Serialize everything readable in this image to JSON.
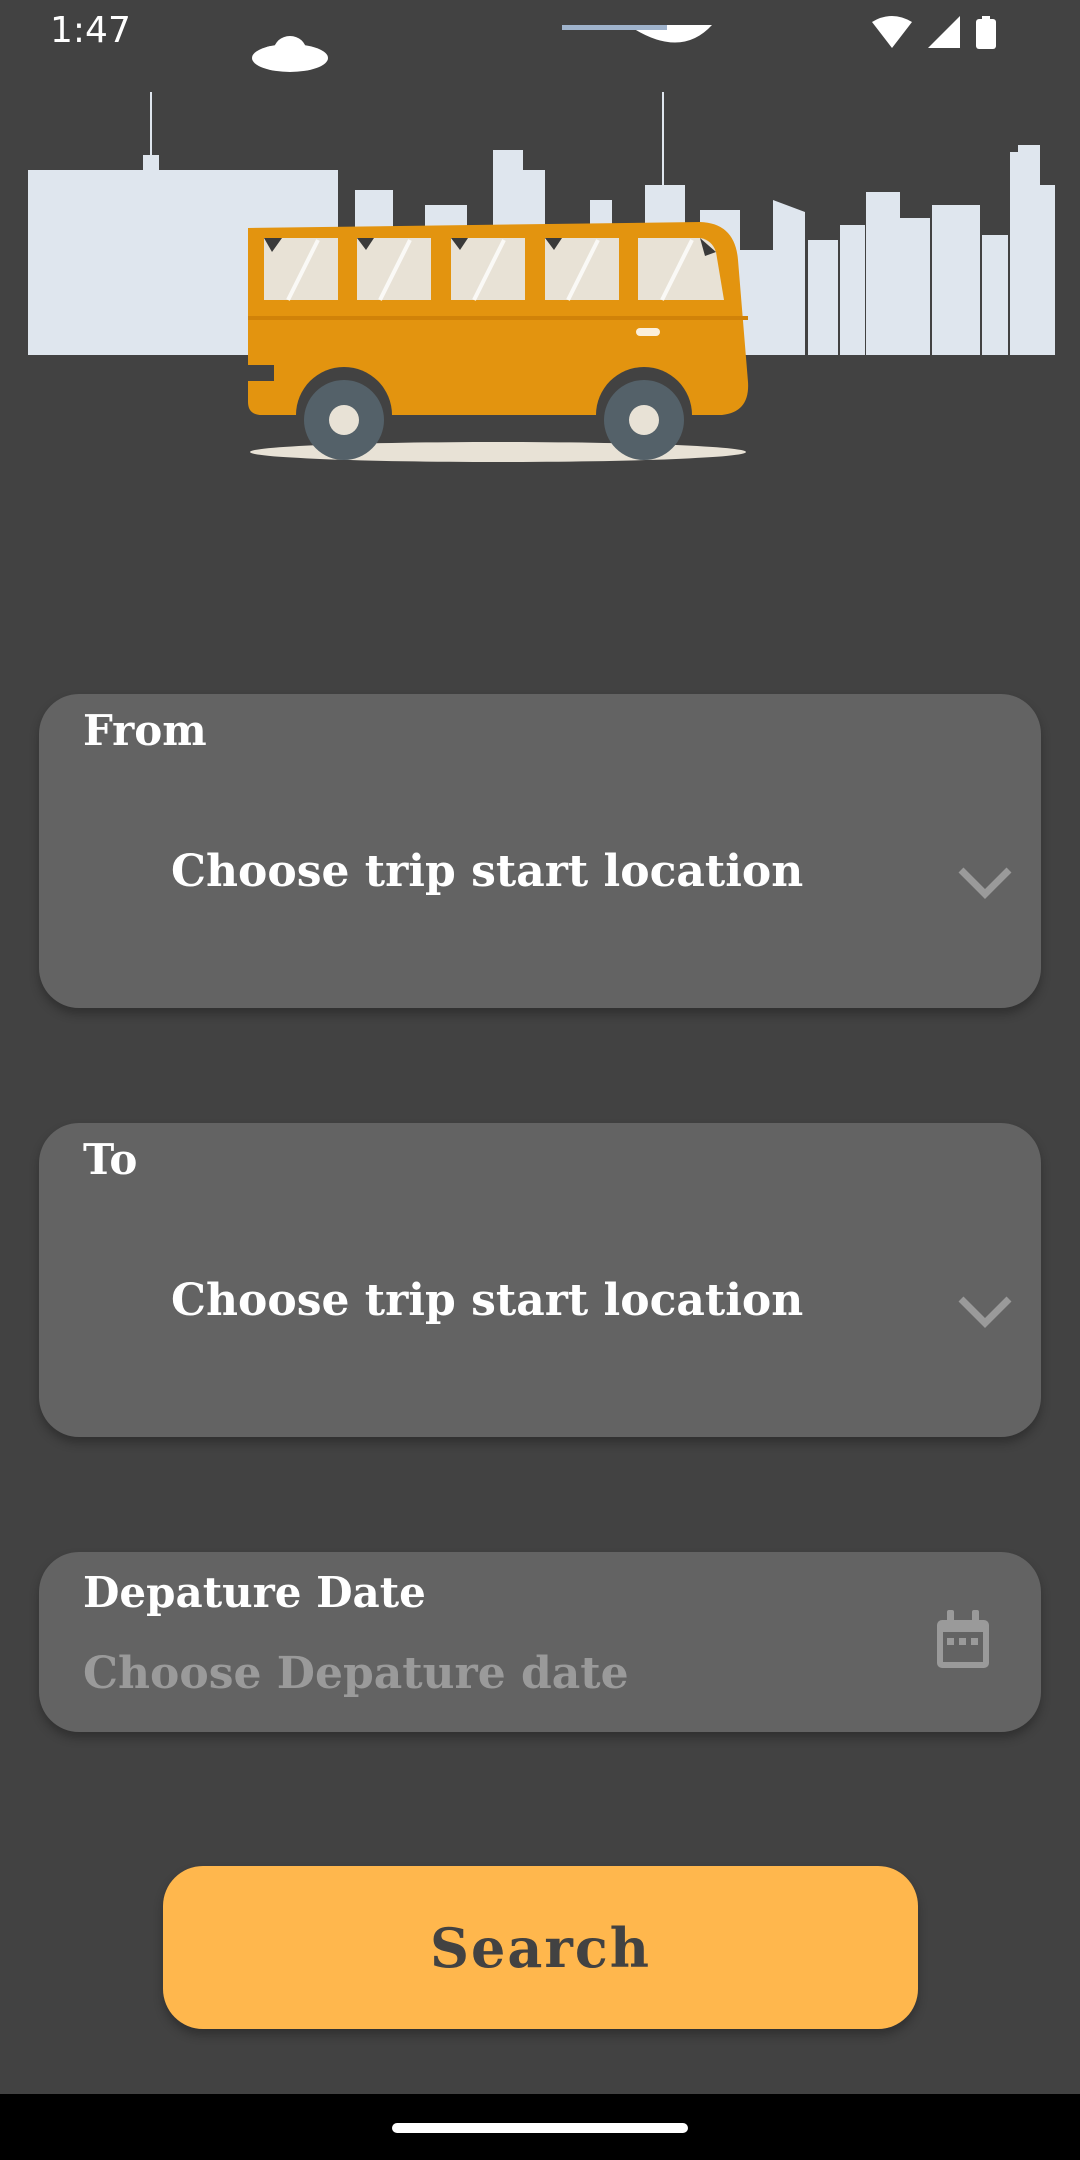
{
  "status_bar": {
    "time": "1:47",
    "icons": [
      "wifi-icon",
      "signal-icon",
      "battery-icon"
    ]
  },
  "hero": {
    "icon": "bus-city-illustration",
    "colors": {
      "bus": "#E3940F",
      "skyline": "#DFE6EE",
      "window": "#E8E2D6",
      "wheel": "#546169"
    }
  },
  "from_card": {
    "label": "From",
    "dropdown_value": "Choose trip start location",
    "icon": "chevron-down-icon"
  },
  "to_card": {
    "label": "To",
    "dropdown_value": "Choose trip start location",
    "icon": "chevron-down-icon"
  },
  "date_card": {
    "label": "Depature Date",
    "placeholder": "Choose Depature date",
    "icon": "calendar-icon"
  },
  "search_button": {
    "label": "Search"
  },
  "colors": {
    "background": "#424242",
    "card": "#636363",
    "accent": "#FFB74D",
    "placeholder": "#9A9A9A",
    "nav_bar": "#000000"
  }
}
